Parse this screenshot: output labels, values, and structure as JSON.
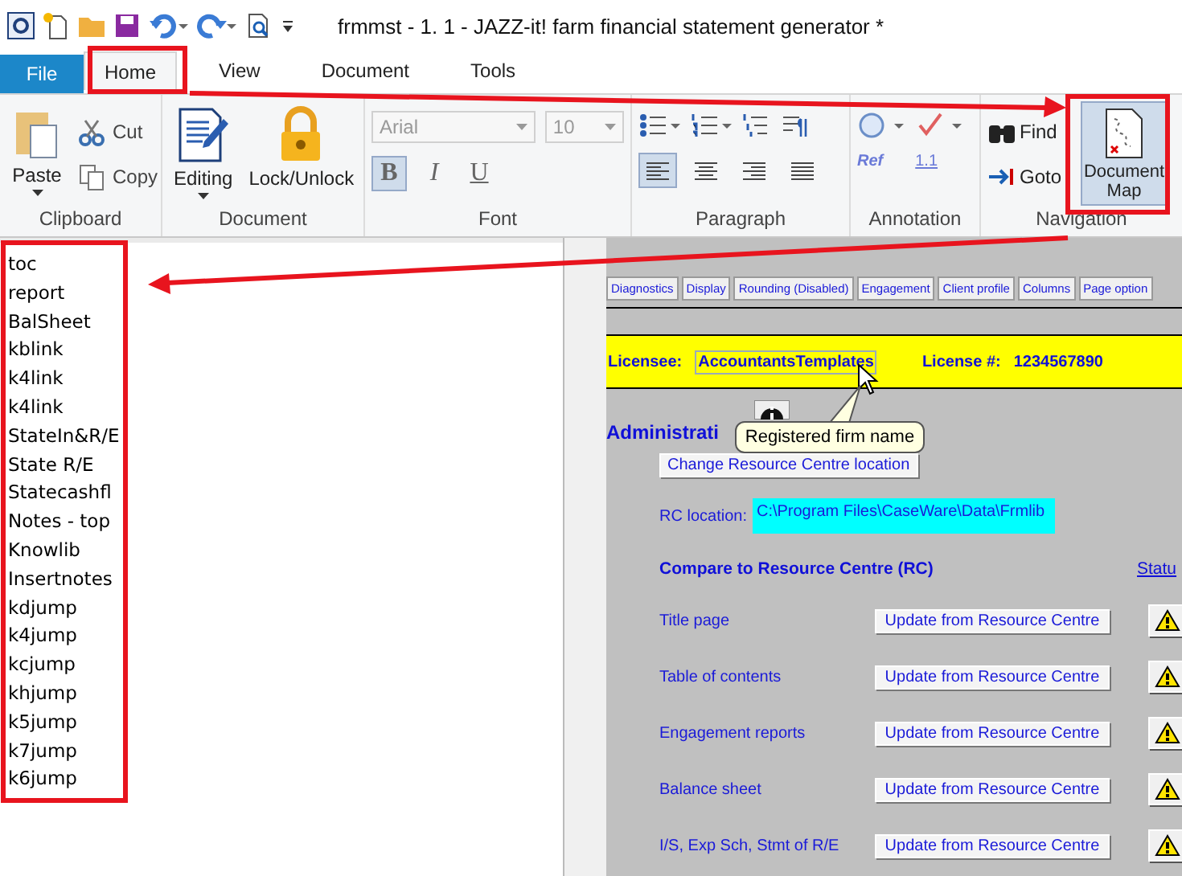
{
  "window": {
    "title": "frmmst - 1. 1 - JAZZ-it! farm financial statement generator *"
  },
  "tabs": [
    {
      "label": "File",
      "kind": "file",
      "selected": false
    },
    {
      "label": "Home",
      "kind": "tab",
      "selected": true
    },
    {
      "label": "View",
      "kind": "tab",
      "selected": false
    },
    {
      "label": "Document",
      "kind": "tab",
      "selected": false
    },
    {
      "label": "Tools",
      "kind": "tab",
      "selected": false
    }
  ],
  "ribbon": {
    "clipboard": {
      "label": "Clipboard",
      "paste": "Paste",
      "cut": "Cut",
      "copy": "Copy"
    },
    "document": {
      "label": "Document",
      "editing": "Editing",
      "lock": "Lock/Unlock"
    },
    "font": {
      "label": "Font",
      "family": "Arial",
      "size": "10",
      "styles": [
        {
          "label": "B",
          "kind": "bold",
          "selected": true
        },
        {
          "label": "I",
          "kind": "italic",
          "selected": false
        },
        {
          "label": "U",
          "kind": "underline",
          "selected": false
        }
      ]
    },
    "paragraph": {
      "label": "Paragraph",
      "alignments": [
        {
          "kind": "left",
          "selected": true
        },
        {
          "kind": "center",
          "selected": false
        },
        {
          "kind": "right",
          "selected": false
        },
        {
          "kind": "justify",
          "selected": false
        }
      ]
    },
    "annotation": {
      "label": "Annotation",
      "ref": "Ref",
      "number": "1.1"
    },
    "navigation": {
      "label": "Navigation",
      "find": "Find",
      "goto": "Goto",
      "document_map": {
        "label": "Document Map",
        "selected": true
      }
    }
  },
  "document_map": {
    "items": [
      "toc",
      "report",
      "BalSheet",
      "kblink",
      "k4link",
      "k4link",
      "StateIn&R/E",
      "State R/E",
      "Statecashfl",
      "Notes - top",
      "Knowlib",
      "Insertnotes",
      "kdjump",
      "k4jump",
      "kcjump",
      "khjump",
      "k5jump",
      "k7jump",
      "k6jump"
    ]
  },
  "document": {
    "buttons": [
      "Diagnostics",
      "Display",
      "Rounding (Disabled)",
      "Engagement",
      "Client profile",
      "Columns",
      "Page option"
    ],
    "licensee": {
      "label": "Licensee:",
      "value": "AccountantsTemplates",
      "number_label": "License #:",
      "number": "1234567890"
    },
    "admin_heading": "Administrati",
    "tooltip": "Registered firm name",
    "change_button": "Change Resource Centre location",
    "rc": {
      "label": "RC location:",
      "value": "C:\\Program Files\\CaseWare\\Data\\Frmlib"
    },
    "compare_heading": "Compare to Resource Centre (RC)",
    "status_link": "Statu",
    "rows": [
      {
        "label": "Title page",
        "button": "Update from Resource Centre"
      },
      {
        "label": "Table of contents",
        "button": "Update from Resource Centre"
      },
      {
        "label": "Engagement reports",
        "button": "Update from Resource Centre"
      },
      {
        "label": "Balance sheet",
        "button": "Update from Resource Centre"
      },
      {
        "label": "I/S, Exp Sch, Stmt of R/E",
        "button": "Update from Resource Centre"
      }
    ]
  }
}
